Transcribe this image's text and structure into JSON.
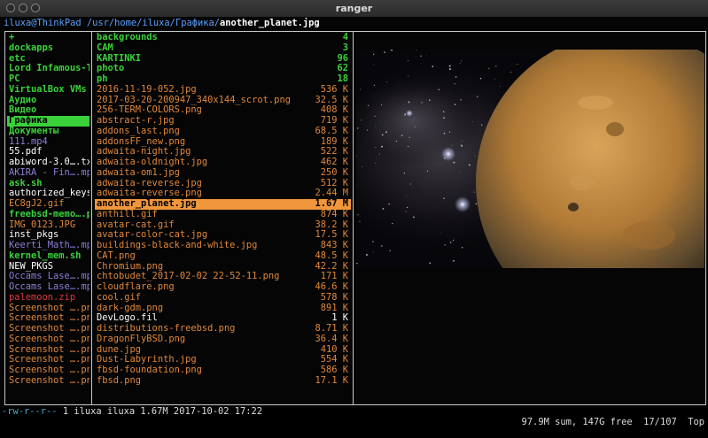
{
  "window": {
    "title": "ranger"
  },
  "path": {
    "host": "iluxa@ThinkPad",
    "dir": " /usr/home/iluxa/Графика/",
    "file": "another_planet.jpg"
  },
  "colors": {
    "dir": "#3ad13a",
    "exe": "#3ad13a",
    "media": "#8c7fd6",
    "image": "#e0873a",
    "plain": "#ffffff",
    "archive": "#e03a3a",
    "selected_bg_parent": "#3ad13a",
    "selected_bg_current": "#f0963c"
  },
  "parent_column": [
    {
      "name": "+",
      "type": "dir"
    },
    {
      "name": "dockapps",
      "type": "dir"
    },
    {
      "name": "etc",
      "type": "dir"
    },
    {
      "name": "Lord Infamous-T…",
      "type": "dir"
    },
    {
      "name": "PC",
      "type": "dir"
    },
    {
      "name": "VirtualBox VMs",
      "type": "dir"
    },
    {
      "name": "Аудио",
      "type": "dir"
    },
    {
      "name": "Видео",
      "type": "dir"
    },
    {
      "name": "Графика",
      "type": "dir",
      "selected": true
    },
    {
      "name": "Документы",
      "type": "dir"
    },
    {
      "name": "111.mp4",
      "type": "media"
    },
    {
      "name": "55.pdf",
      "type": "plain"
    },
    {
      "name": "abiword-3.0….txz",
      "type": "plain"
    },
    {
      "name": "AKIRA - Fin….mp3",
      "type": "media"
    },
    {
      "name": "ask.sh",
      "type": "exe"
    },
    {
      "name": "authorized_keys",
      "type": "plain"
    },
    {
      "name": "EC8gJ2.gif",
      "type": "image"
    },
    {
      "name": "freebsd-memo….pl",
      "type": "exe"
    },
    {
      "name": "IMG_0123.JPG",
      "type": "image"
    },
    {
      "name": "inst_pkgs",
      "type": "plain"
    },
    {
      "name": "Keerti_Math….mp3",
      "type": "media"
    },
    {
      "name": "kernel_mem.sh",
      "type": "exe"
    },
    {
      "name": "NEW_PKGS",
      "type": "plain"
    },
    {
      "name": "Occams Lase….mp3",
      "type": "media"
    },
    {
      "name": "Occams Lase….mp3",
      "type": "media"
    },
    {
      "name": "palemoon.zip",
      "type": "archive"
    },
    {
      "name": "Screenshot ….png",
      "type": "image"
    },
    {
      "name": "Screenshot ….png",
      "type": "image"
    },
    {
      "name": "Screenshot ….png",
      "type": "image"
    },
    {
      "name": "Screenshot ….png",
      "type": "image"
    },
    {
      "name": "Screenshot ….png",
      "type": "image"
    },
    {
      "name": "Screenshot ….png",
      "type": "image"
    },
    {
      "name": "Screenshot ….png",
      "type": "image"
    },
    {
      "name": "Screenshot ….png",
      "type": "image"
    }
  ],
  "current_column": [
    {
      "name": "backgrounds",
      "size": "4",
      "type": "dir"
    },
    {
      "name": "CAM",
      "size": "3",
      "type": "dir"
    },
    {
      "name": "KARTINKI",
      "size": "96",
      "type": "dir"
    },
    {
      "name": "photo",
      "size": "62",
      "type": "dir"
    },
    {
      "name": "ph",
      "size": "18",
      "type": "dir"
    },
    {
      "name": "2016-11-19-052.jpg",
      "size": "536 K",
      "type": "image"
    },
    {
      "name": "2017-03-20-200947_340x144_scrot.png",
      "size": "32.5 K",
      "type": "image"
    },
    {
      "name": "256-TERM-COLORS.png",
      "size": "408 K",
      "type": "image"
    },
    {
      "name": "abstract-r.jpg",
      "size": "719 K",
      "type": "image"
    },
    {
      "name": "addons_last.png",
      "size": "68.5 K",
      "type": "image"
    },
    {
      "name": "addonsFF_new.png",
      "size": "189 K",
      "type": "image"
    },
    {
      "name": "adwaita-night.jpg",
      "size": "522 K",
      "type": "image"
    },
    {
      "name": "adwaita-oldnight.jpg",
      "size": "462 K",
      "type": "image"
    },
    {
      "name": "adwaita-om1.jpg",
      "size": "250 K",
      "type": "image"
    },
    {
      "name": "adwaita-reverse.jpg",
      "size": "512 K",
      "type": "image"
    },
    {
      "name": "adwaita-reverse.png",
      "size": "2.44 M",
      "type": "image"
    },
    {
      "name": "another_planet.jpg",
      "size": "1.67 M",
      "type": "image",
      "selected": true
    },
    {
      "name": "anthill.gif",
      "size": "874 K",
      "type": "image"
    },
    {
      "name": "avatar-cat.gif",
      "size": "38.2 K",
      "type": "image"
    },
    {
      "name": "avatar-color-cat.jpg",
      "size": "17.5 K",
      "type": "image"
    },
    {
      "name": "buildings-black-and-white.jpg",
      "size": "843 K",
      "type": "image"
    },
    {
      "name": "CAT.png",
      "size": "48.5 K",
      "type": "image"
    },
    {
      "name": "Chromium.png",
      "size": "42.2 K",
      "type": "image"
    },
    {
      "name": "chtobudet_2017-02-02 22-52-11.png",
      "size": "171 K",
      "type": "image"
    },
    {
      "name": "cloudflare.png",
      "size": "46.6 K",
      "type": "image"
    },
    {
      "name": "cool.gif",
      "size": "578 K",
      "type": "image"
    },
    {
      "name": "dark-gdm.png",
      "size": "891 K",
      "type": "image"
    },
    {
      "name": "DevLogo.fil",
      "size": "1 K",
      "type": "plain"
    },
    {
      "name": "distributions-freebsd.png",
      "size": "8.71 K",
      "type": "image"
    },
    {
      "name": "DragonFlyBSD.png",
      "size": "36.4 K",
      "type": "image"
    },
    {
      "name": "dune.jpg",
      "size": "410 K",
      "type": "image"
    },
    {
      "name": "Dust-Labyrinth.jpg",
      "size": "554 K",
      "type": "image"
    },
    {
      "name": "fbsd-foundation.png",
      "size": "586 K",
      "type": "image"
    },
    {
      "name": "fbsd.png",
      "size": "17.1 K",
      "type": "image"
    }
  ],
  "status": {
    "perms": "-rw-r--r--",
    "info": " 1 iluxa iluxa 1.67M 2017-10-02 17:22",
    "summary": "97.9M sum, 147G free  17/107  Top"
  },
  "preview": {
    "subject": "planet-and-nebula-image"
  }
}
